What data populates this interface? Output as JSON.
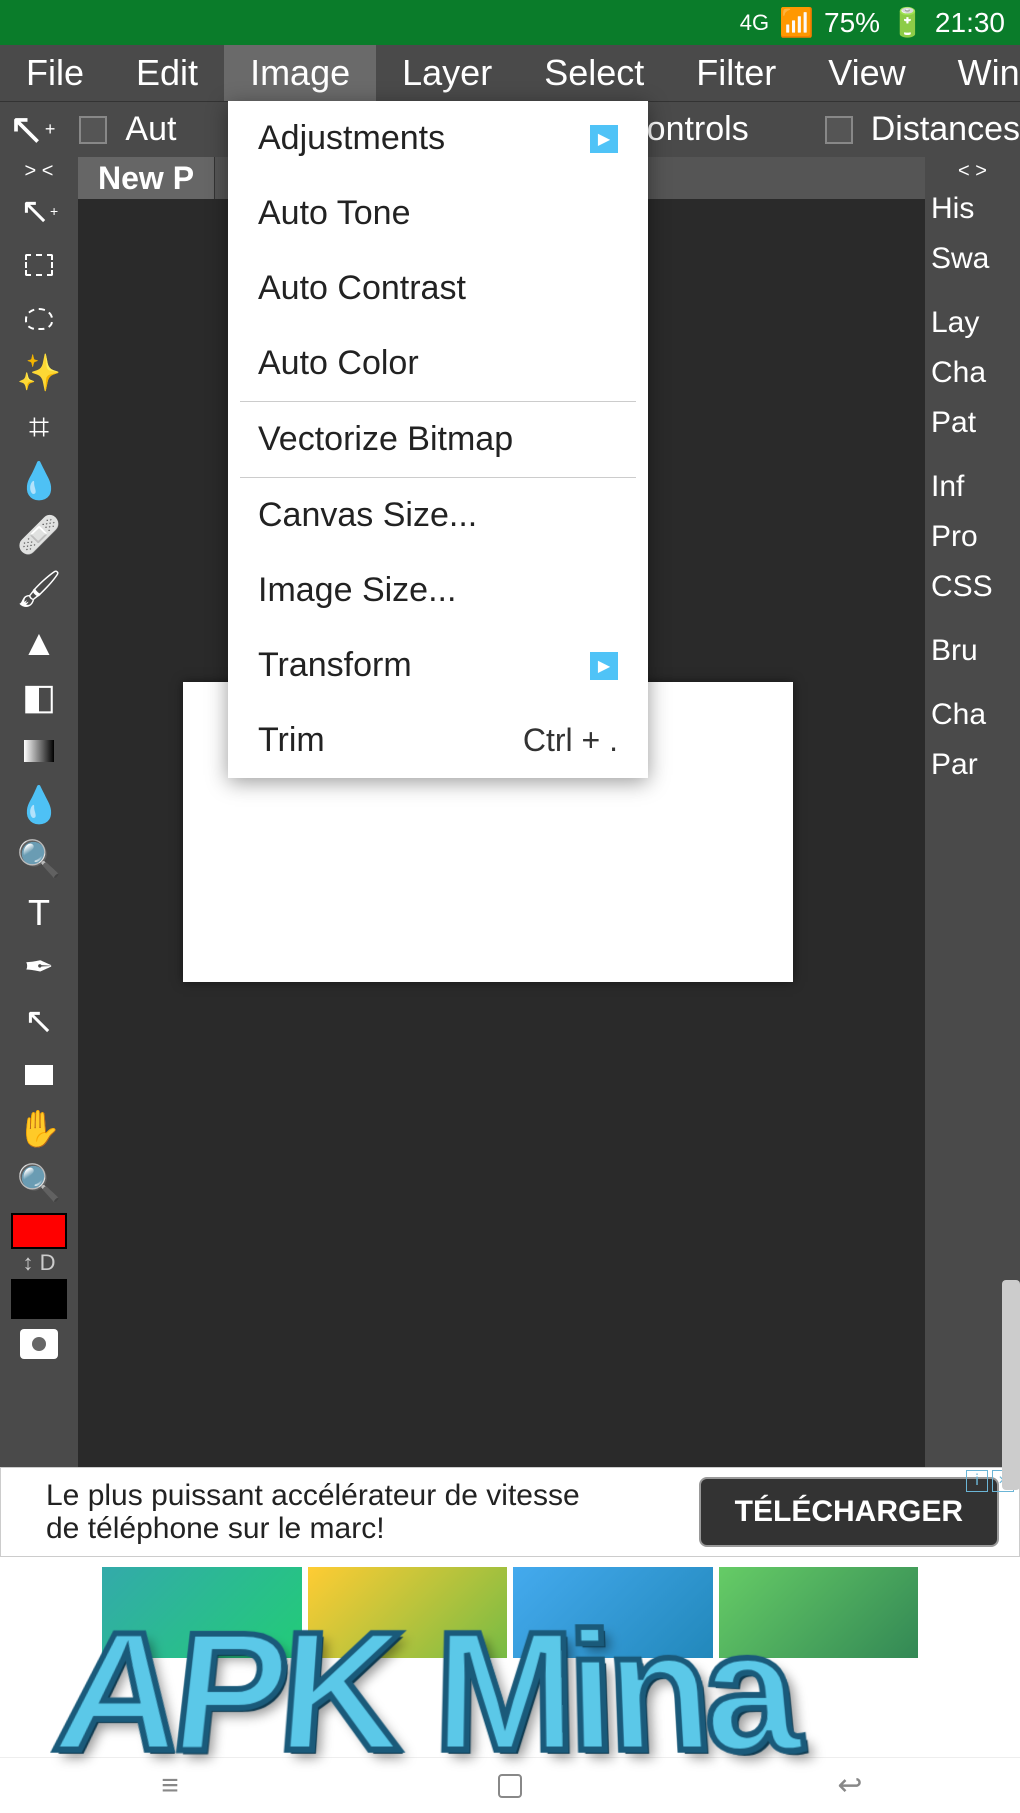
{
  "status_bar": {
    "network": "4G",
    "battery_pct": "75%",
    "time": "21:30"
  },
  "menu_bar": {
    "items": [
      "File",
      "Edit",
      "Image",
      "Layer",
      "Select",
      "Filter",
      "View",
      "Wind"
    ],
    "active_index": 2
  },
  "toolbar_options": {
    "auto_label": "Aut",
    "controls_label": "ontrols",
    "distances_label": "Distances"
  },
  "tab": {
    "name": "New P"
  },
  "dropdown": {
    "items": [
      {
        "label": "Adjustments",
        "submenu": true
      },
      {
        "label": "Auto Tone"
      },
      {
        "label": "Auto Contrast"
      },
      {
        "label": "Auto Color"
      },
      {
        "divider": true
      },
      {
        "label": "Vectorize Bitmap"
      },
      {
        "divider": true
      },
      {
        "label": "Canvas Size..."
      },
      {
        "label": "Image Size..."
      },
      {
        "label": "Transform",
        "submenu": true
      },
      {
        "label": "Trim",
        "shortcut": "Ctrl + ."
      }
    ]
  },
  "right_panel": {
    "arrows": "< >",
    "items": [
      "His",
      "Swa",
      "",
      "Lay",
      "Cha",
      "Pat",
      "",
      "Inf",
      "Pro",
      "CSS",
      "",
      "Bru",
      "",
      "Cha",
      "Par"
    ]
  },
  "tool_panel": {
    "arrows": "> <",
    "swap_label": "↕ D"
  },
  "ad": {
    "text": "Le plus puissant accélérateur de vitesse de téléphone sur le marc!",
    "button": "TÉLÉCHARGER"
  },
  "watermark": "APK Mina"
}
